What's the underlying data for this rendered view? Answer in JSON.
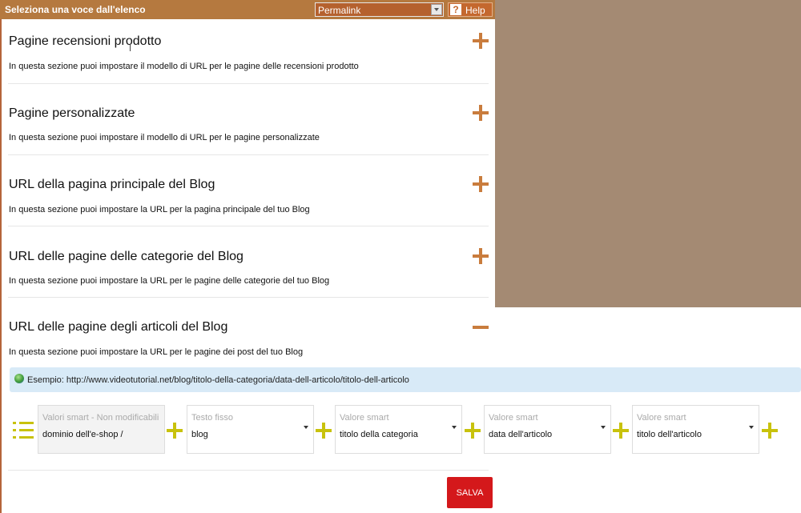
{
  "header": {
    "title": "Seleziona una voce dall'elenco",
    "select_value": "Permalink",
    "help_symbol": "?",
    "help_label": "Help"
  },
  "sections": [
    {
      "title": "Pagine recensioni prodotto",
      "description": "In questa sezione puoi impostare il modello di URL per le pagine delle recensioni prodotto",
      "state": "collapsed"
    },
    {
      "title": "Pagine personalizzate",
      "description": "In questa sezione puoi impostare il modello di URL per le pagine personalizzate",
      "state": "collapsed"
    },
    {
      "title": "URL della pagina principale del Blog",
      "description": "In questa sezione puoi impostare la URL per la pagina principale del tuo Blog",
      "state": "collapsed"
    },
    {
      "title": "URL delle pagine delle categorie del Blog",
      "description": "In questa sezione puoi impostare la URL per le pagine delle categorie del tuo Blog",
      "state": "collapsed"
    },
    {
      "title": "URL delle pagine degli articoli del Blog",
      "description": "In questa sezione puoi impostare la URL per le pagine dei post del tuo Blog",
      "state": "expanded"
    }
  ],
  "example": {
    "text": "Esempio: http://www.videotutorial.net/blog/titolo-della-categoria/data-dell-articolo/titolo-dell-articolo"
  },
  "url_builder": {
    "fields": [
      {
        "label": "Valori smart - Non modificabili",
        "value": "dominio dell'e-shop /"
      },
      {
        "label": "Testo fisso",
        "value": "blog"
      },
      {
        "label": "Valore smart",
        "value": "titolo della categoria"
      },
      {
        "label": "Valore smart",
        "value": "data dell'articolo"
      },
      {
        "label": "Valore smart",
        "value": "titolo dell'articolo"
      }
    ]
  },
  "save_label": "SALVA",
  "colors": {
    "header_bg": "#b5793f",
    "accent_orange": "#c97c3d",
    "accent_yellow": "#c8c20c",
    "save_red": "#d4181b",
    "example_bg": "#d8eaf7",
    "backdrop": "#a48a73"
  }
}
